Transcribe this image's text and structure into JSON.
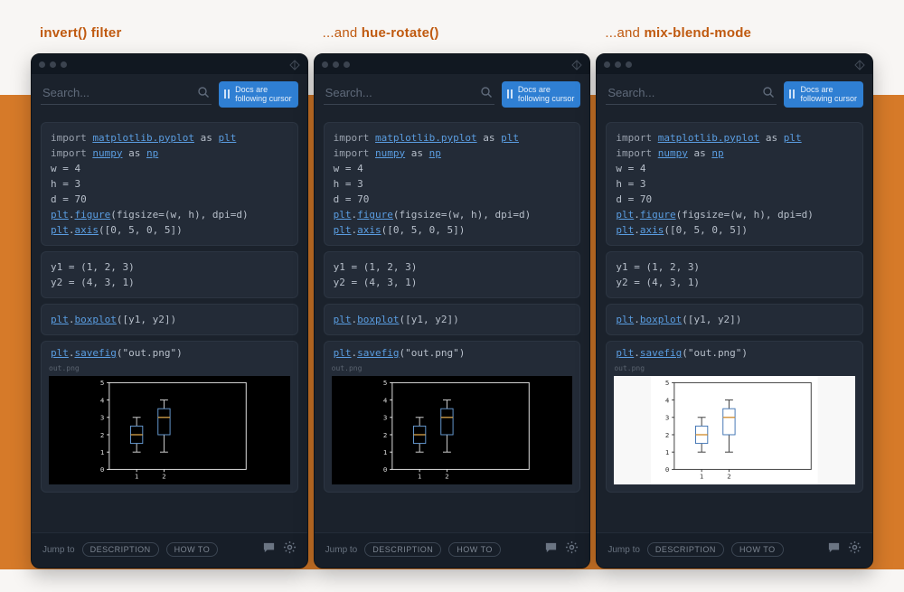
{
  "columns": [
    {
      "title_prefix": "",
      "title_bold": "invert() filter",
      "title_suffix": "",
      "plot_style": "dark"
    },
    {
      "title_prefix": "...and ",
      "title_bold": "hue-rotate()",
      "title_suffix": "",
      "plot_style": "dark"
    },
    {
      "title_prefix": "...and ",
      "title_bold": "mix-blend-mode",
      "title_suffix": "",
      "plot_style": "light"
    }
  ],
  "search": {
    "placeholder": "Search..."
  },
  "docs_button": {
    "line1": "Docs are",
    "line2": "following cursor"
  },
  "code": {
    "block1": [
      {
        "t": "import ",
        "c": "kw"
      },
      {
        "t": "matplotlib.pyplot",
        "c": "mod"
      },
      {
        "t": " as "
      },
      {
        "t": "plt",
        "c": "mod"
      },
      {
        "br": true
      },
      {
        "t": "import ",
        "c": "kw"
      },
      {
        "t": "numpy",
        "c": "mod"
      },
      {
        "t": " as "
      },
      {
        "t": "np",
        "c": "mod"
      },
      {
        "br": true
      },
      {
        "t": "w = 4"
      },
      {
        "br": true
      },
      {
        "t": "h = 3"
      },
      {
        "br": true
      },
      {
        "t": "d = 70"
      },
      {
        "br": true
      },
      {
        "t": "plt",
        "c": "mod"
      },
      {
        "t": "."
      },
      {
        "t": "figure",
        "c": "mod"
      },
      {
        "t": "(figsize=(w, h), dpi=d)"
      },
      {
        "br": true
      },
      {
        "t": "plt",
        "c": "mod"
      },
      {
        "t": "."
      },
      {
        "t": "axis",
        "c": "mod"
      },
      {
        "t": "([0, 5, 0, 5])"
      }
    ],
    "block2": [
      {
        "t": "y1 = (1, 2, 3)"
      },
      {
        "br": true
      },
      {
        "t": "y2 = (4, 3, 1)"
      }
    ],
    "block3": [
      {
        "t": "plt",
        "c": "mod"
      },
      {
        "t": "."
      },
      {
        "t": "boxplot",
        "c": "mod"
      },
      {
        "t": "([y1, y2])"
      }
    ],
    "block4": [
      {
        "t": "plt",
        "c": "mod"
      },
      {
        "t": "."
      },
      {
        "t": "savefig",
        "c": "mod"
      },
      {
        "t": "(\"out.png\")"
      }
    ]
  },
  "plot_label": "out.png",
  "footer": {
    "jump_to": "Jump to",
    "pill1": "DESCRIPTION",
    "pill2": "HOW TO"
  },
  "chart_data": {
    "type": "boxplot",
    "xlim": [
      0,
      5
    ],
    "ylim": [
      0,
      5
    ],
    "xticks": [
      1,
      2
    ],
    "yticks": [
      0,
      1,
      2,
      3,
      4,
      5
    ],
    "series": [
      {
        "name": "y1",
        "values": [
          1,
          2,
          3
        ],
        "min": 1,
        "q1": 1.5,
        "median": 2,
        "q3": 2.5,
        "max": 3
      },
      {
        "name": "y2",
        "values": [
          4,
          3,
          1
        ],
        "min": 1,
        "q1": 2.0,
        "median": 3,
        "q3": 3.5,
        "max": 4
      }
    ],
    "title": "",
    "xlabel": "",
    "ylabel": ""
  }
}
